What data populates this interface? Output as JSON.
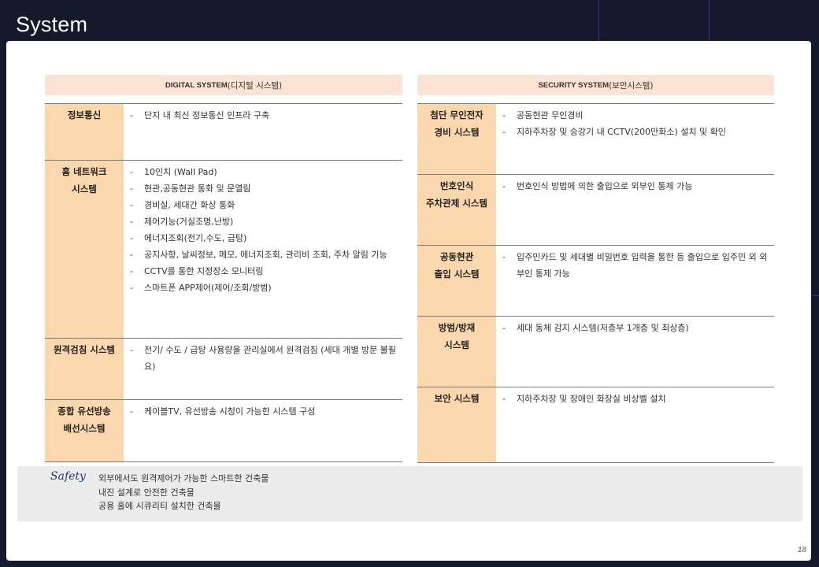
{
  "title": "System",
  "digital": {
    "header_bold": "DIGITAL SYSTEM",
    "header_rest": "(디지털 시스템)",
    "rows": [
      {
        "category": "정보통신",
        "items": [
          "단지 내 최신 정보통신 인프라 구축"
        ]
      },
      {
        "category": "홈 네트워크\n시스템",
        "items": [
          "10인치 (Wall Pad)",
          "현관,공동현관 통화 및 문열림",
          "경비실, 세대간 화상 통화",
          "제어기능(거실조명,난방)",
          "에너지조회(전기,수도, 급탕)",
          "공지사항, 날씨정보, 메모, 에너지조회, 관리비 조회, 주차 알림 기능",
          "CCTV를 통한 지정장소 모니터링",
          "스마트폰 APP제어(제어/조회/방범)"
        ]
      },
      {
        "category": "원격검침 시스템",
        "items": [
          "전기/ 수도 / 급탕 사용량을 관리실에서 원격검침 (세대 개별 방문 불필요)"
        ]
      },
      {
        "category": "종합 유선방송\n배선시스템",
        "items": [
          "케이블TV, 유선방송 시청이 가능한 시스템 구성"
        ]
      }
    ]
  },
  "security": {
    "header_bold": "SECURITY SYSTEM",
    "header_rest": "(보안시스템)",
    "rows": [
      {
        "category": "첨단 무인전자\n경비 시스템",
        "items": [
          "공동현관 무인경비",
          "지하주차장 및 승강기 내 CCTV(200만화소) 설치 및 확인"
        ]
      },
      {
        "category": "번호인식\n주차관제 시스템",
        "items": [
          "번호인식 방법에 의한 출입으로 외부인 통제 가능"
        ]
      },
      {
        "category": "공동현관\n출입 시스템",
        "items": [
          "입주민카드 및 세대별 비밀번호 입력을 통한 등 출입으로 입주민 외 외부인 통제 가능"
        ]
      },
      {
        "category": "방범/방재\n시스템",
        "items": [
          "세대 동체 감지 시스템(저층부 1개층 및 최상층)"
        ]
      },
      {
        "category": "보안 시스템",
        "items": [
          "지하주차장 및 장애인 화장실 비상벨 설치"
        ]
      }
    ]
  },
  "safety": {
    "label": "Safety",
    "lines": [
      "외부에서도 원격제어가 가능한 스마트한 건축물",
      "내진 설계로 안전한 건축물",
      "공용 홀에 시큐리티 설치한 건축물"
    ]
  },
  "page_number": "18"
}
